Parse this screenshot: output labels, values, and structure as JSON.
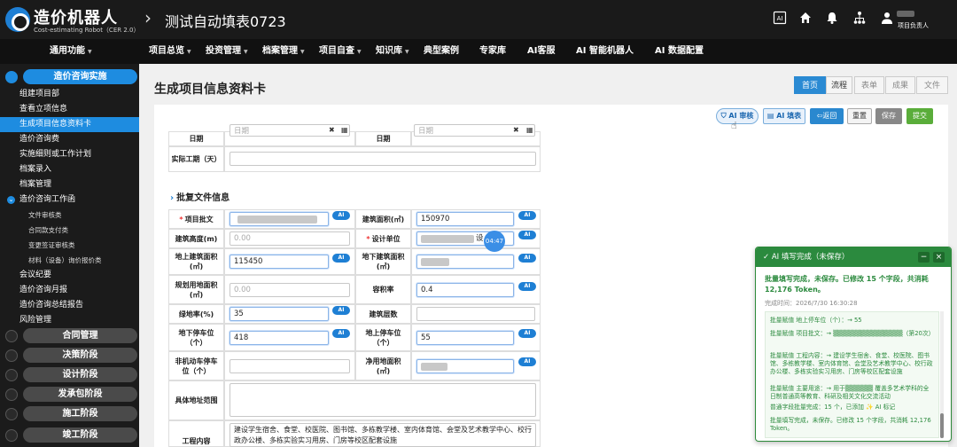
{
  "app": {
    "logo_name": "造价机器人",
    "logo_sub": "Cost-estimating Robot（CER 2.0）",
    "title": "测试自动填表0723",
    "user_label": "项目负责人",
    "icons": [
      "ai-icon",
      "home-icon",
      "bell-icon",
      "org-chart-icon",
      "user-icon"
    ]
  },
  "menu": [
    {
      "label": "通用功能",
      "caret": true
    },
    {
      "label": "项目总览",
      "caret": true
    },
    {
      "label": "投资管理",
      "caret": true
    },
    {
      "label": "档案管理",
      "caret": true
    },
    {
      "label": "项目自查",
      "caret": true
    },
    {
      "label": "知识库",
      "caret": true
    },
    {
      "label": "典型案例",
      "caret": false
    },
    {
      "label": "专家库",
      "caret": false
    },
    {
      "label": "AI客服",
      "caret": false
    },
    {
      "label": "AI 智能机器人",
      "caret": false
    },
    {
      "label": "AI 数据配置",
      "caret": false
    }
  ],
  "sidebar": {
    "active_header": "造价咨询实施",
    "items": [
      "组建项目部",
      "查看立项信息",
      "生成项目信息资料卡",
      "造价咨询费",
      "实施细则或工作计划",
      "档案录入",
      "档案管理"
    ],
    "group": "造价咨询工作函",
    "sub_items": [
      "文件审核类",
      "合同款支付类",
      "变更签证审核类",
      "材料（设备）询价报价类"
    ],
    "more_items": [
      "会议纪要",
      "造价咨询月报",
      "造价咨询总结报告",
      "风险管理"
    ],
    "headers": [
      "合同管理",
      "决策阶段",
      "设计阶段",
      "发承包阶段",
      "施工阶段",
      "竣工阶段"
    ]
  },
  "page": {
    "title": "生成项目信息资料卡",
    "tabs": [
      "首页",
      "流程",
      "表单",
      "成果",
      "文件"
    ]
  },
  "toolbar": {
    "ai_review": "AI 审核",
    "ai_fill": "AI 填表",
    "back": "返回",
    "reset": "重置",
    "save": "保存",
    "submit": "提交"
  },
  "form": {
    "date_label": "日期",
    "date_placeholder": "日期",
    "actual_period_label": "实际工期（天）",
    "section_title": "批复文件信息",
    "ai_tag": "AI",
    "project_approval_label": "项目批文",
    "building_area_label": "建筑面积(㎡)",
    "building_area_value": "150970",
    "building_height_label": "建筑高度(m)",
    "building_height_value": "0.00",
    "design_unit_label": "设计单位",
    "design_unit_partial": "设",
    "above_area_label": "地上建筑面积(㎡)",
    "above_area_value": "115450",
    "below_area_label": "地下建筑面积(㎡)",
    "planned_land_label": "规划用地面积(㎡)",
    "planned_land_value": "0.00",
    "plot_ratio_label": "容积率",
    "plot_ratio_value": "0.4",
    "green_ratio_label": "绿地率(%)",
    "green_ratio_value": "35",
    "floors_label": "建筑层数",
    "underground_parking_label": "地下停车位（个）",
    "underground_parking_value": "418",
    "above_parking_label": "地上停车位（个）",
    "above_parking_value": "55",
    "nonmotor_label": "非机动车停车位（个）",
    "net_land_label": "净用地面积(㎡)",
    "address_label": "具体地址范围",
    "content_label": "工程内容",
    "content_value": "建设学生宿舍、食堂、校医院、图书馆、多栋教学楼、室内体育馆、会堂及艺术教学中心、校行政办公楼、多栋实验实习用房、门房等校区配套设施"
  },
  "time_badge": "04:47",
  "panel": {
    "title": "AI 填写完成（未保存）",
    "min_btn": "−",
    "close_btn": "×",
    "summary": "批量填写完成，未保存。已修改 15 个字段，共消耗 12,176 Token。",
    "time": "完成时间：2026/7/30 16:30:28",
    "logs": [
      "批量赋值 地上停车位（个）：→ 55",
      "批量赋值 项目批文：→ ▒▒▒▒▒▒▒▒▒▒▒▒▒▒▒（第20次）",
      "批量赋值 工程内容：→ 建设学生宿舍、食堂、校医院、图书馆、多栋教学楼、室内体育馆、会堂及艺术教学中心、校行政办公楼、多栋实验实习用房、门房等校区配套设施",
      "批量赋值 主要用途：→ 用于▒▒▒▒▒▒ 覆盖多艺术学科的全日制普通高等教育、科研及相关文化交流活动",
      "普通字段批量完成：15 个，已添加 ✨ AI 标记",
      "批量填写完成，未保存。已修改 15 个字段，共消耗 12,176 Token。"
    ]
  }
}
